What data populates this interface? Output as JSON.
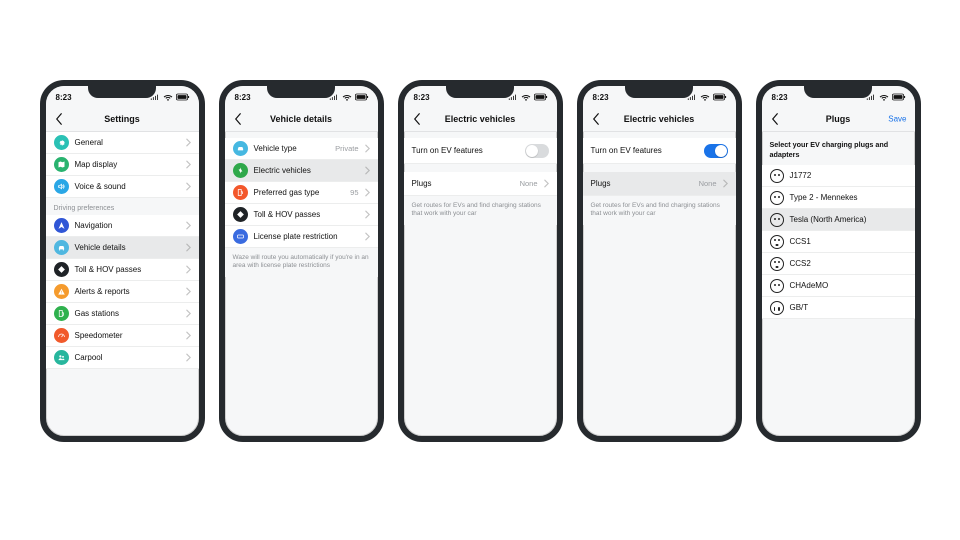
{
  "status": {
    "time": "8:23"
  },
  "screens": [
    {
      "title": "Settings",
      "items": [
        {
          "icon": "gear",
          "color": "#2ac1b5",
          "label": "General"
        },
        {
          "icon": "map",
          "color": "#29b36f",
          "label": "Map display"
        },
        {
          "icon": "voice",
          "color": "#2aa7e6",
          "label": "Voice & sound"
        }
      ],
      "subheader": "Driving preferences",
      "items2": [
        {
          "icon": "nav",
          "color": "#3056d6",
          "label": "Navigation"
        },
        {
          "icon": "car",
          "color": "#4fb7e0",
          "label": "Vehicle details",
          "highlight": true
        },
        {
          "icon": "toll",
          "color": "#1f2327",
          "label": "Toll & HOV passes"
        },
        {
          "icon": "alert",
          "color": "#f59b2d",
          "label": "Alerts & reports"
        },
        {
          "icon": "gas",
          "color": "#2fb14e",
          "label": "Gas stations"
        },
        {
          "icon": "speedo",
          "color": "#f15a2b",
          "label": "Speedometer"
        },
        {
          "icon": "carpool",
          "color": "#27b69d",
          "label": "Carpool"
        }
      ]
    },
    {
      "title": "Vehicle details",
      "items": [
        {
          "icon": "car",
          "color": "#46b8e1",
          "label": "Vehicle type",
          "value": "Private"
        },
        {
          "icon": "ev",
          "color": "#2fa84a",
          "label": "Electric vehicles",
          "highlight": true
        },
        {
          "icon": "gas",
          "color": "#f3572b",
          "label": "Preferred gas type",
          "value": "95"
        },
        {
          "icon": "toll",
          "color": "#1f2327",
          "label": "Toll & HOV passes"
        },
        {
          "icon": "plate",
          "color": "#3a6be0",
          "label": "License plate restriction"
        }
      ],
      "hint": "Waze will route you automatically if you're in an area with license plate restrictions"
    },
    {
      "title": "Electric vehicles",
      "toggle": {
        "label": "Turn on EV features",
        "on": false
      },
      "plugs": {
        "label": "Plugs",
        "value": "None"
      },
      "hint": "Get routes for EVs and find charging stations that work with your car"
    },
    {
      "title": "Electric vehicles",
      "toggle": {
        "label": "Turn on EV features",
        "on": true
      },
      "plugs": {
        "label": "Plugs",
        "value": "None",
        "highlight": true
      },
      "hint": "Get routes for EVs and find charging stations that work with your car"
    },
    {
      "title": "Plugs",
      "save": "Save",
      "instr": "Select your EV charging plugs and adapters",
      "plugrows": [
        {
          "label": "J1772"
        },
        {
          "label": "Type 2 - Mennekes"
        },
        {
          "label": "Tesla (North America)",
          "highlight": true
        },
        {
          "label": "CCS1"
        },
        {
          "label": "CCS2"
        },
        {
          "label": "CHAdeMO"
        },
        {
          "label": "GB/T"
        }
      ]
    }
  ]
}
